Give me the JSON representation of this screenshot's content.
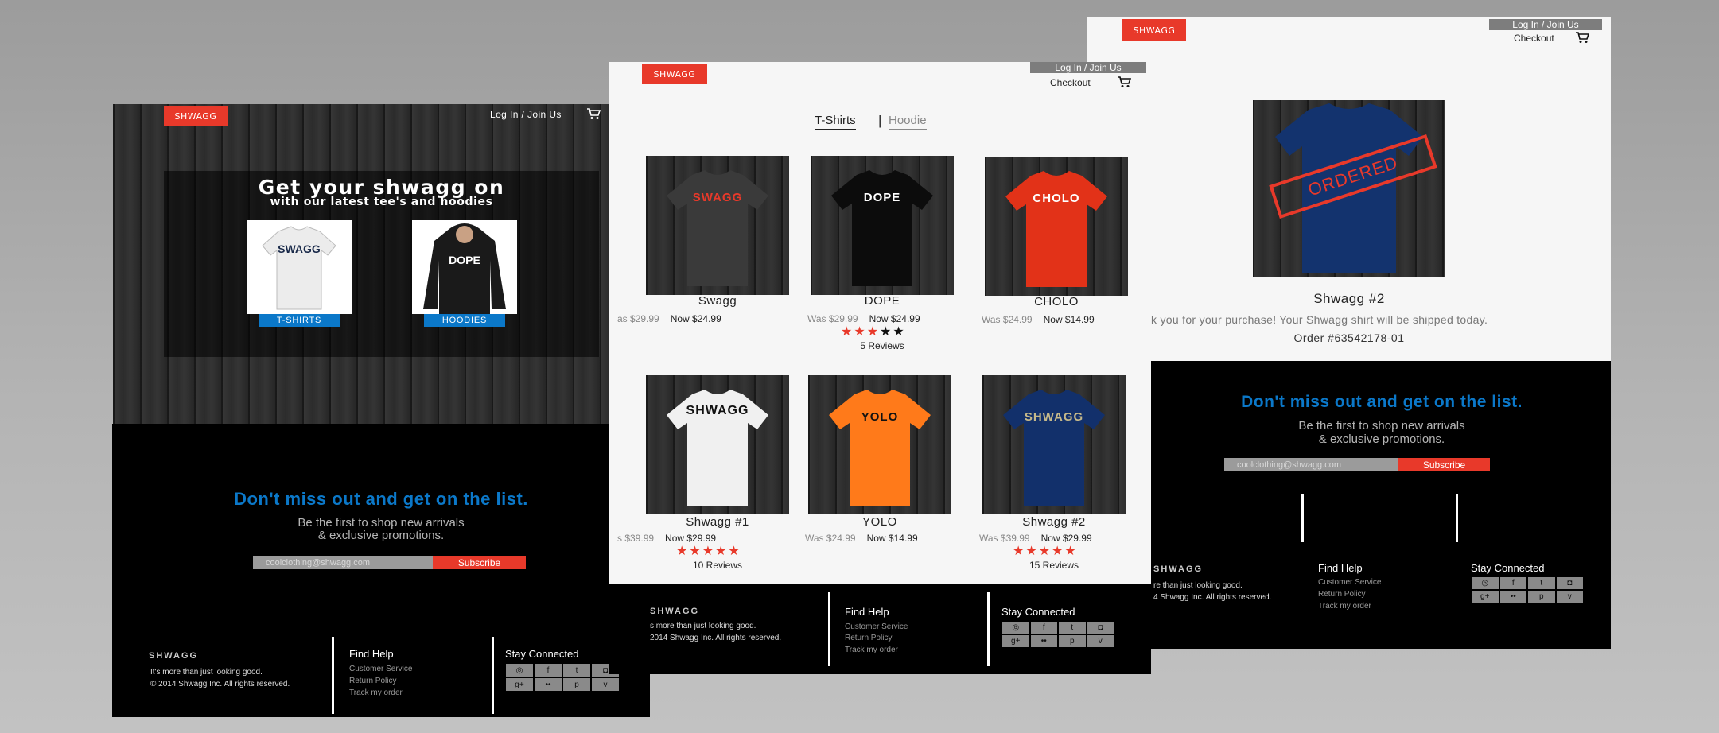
{
  "brand": {
    "logo_text": "SHWAGG",
    "wordmark": "SHWAGG",
    "accent": "#e8392a",
    "blue": "#0b78c9"
  },
  "home": {
    "login": "Log In / Join Us",
    "hero_title": "Get your shwagg on",
    "hero_sub": "with our latest tee's and hoodies",
    "tshirts_label": "T-SHIRTS",
    "hoodies_label": "HOODIES",
    "tee_graphic": "SWAGG",
    "hoodie_graphic": "DOPE"
  },
  "newsletter": {
    "title": "Don't miss out and get on the list.",
    "line1": "Be the first to shop new arrivals",
    "line2": "& exclusive promotions.",
    "email_placeholder": "coolclothing@shwagg.com",
    "subscribe": "Subscribe"
  },
  "footer": {
    "tagline": "It's more than just looking good.",
    "copyright": "2014 Shwagg Inc. All rights reserved.",
    "tagline_cropped": "s more than just looking good.",
    "copyright_cropped": "2014 Shwagg Inc. All rights reserved.",
    "tagline_cropped2": "re than just looking good.",
    "copyright_cropped2": "4 Shwagg Inc. All rights reserved.",
    "help_title": "Find Help",
    "help_links": [
      "Customer Service",
      "Return Policy",
      "Track my order"
    ],
    "social_title": "Stay Connected",
    "social_icons": [
      "dribbble-icon",
      "facebook-icon",
      "twitter-icon",
      "instagram-icon",
      "google-plus-icon",
      "flickr-icon",
      "pinterest-icon",
      "vimeo-icon"
    ]
  },
  "catalog": {
    "login": "Log In / Join Us",
    "checkout": "Checkout",
    "tab_tshirts": "T-Shirts",
    "tab_separator": "|",
    "tab_hoodie": "Hoodie",
    "products": [
      {
        "name": "Swagg",
        "was": "as $29.99",
        "now": "Now $24.99",
        "graphic": "SWAGG",
        "shirt_color": "#3a3a3a",
        "text_color": "#e8392a"
      },
      {
        "name": "DOPE",
        "was": "Was $29.99",
        "now": "Now $24.99",
        "rating": 3,
        "reviews": "5 Reviews",
        "graphic": "DOPE",
        "shirt_color": "#0c0c0c",
        "text_color": "#fff"
      },
      {
        "name": "CHOLO",
        "was": "Was $24.99",
        "now": "Now $14.99",
        "graphic": "CHOLO",
        "shirt_color": "#e23218",
        "text_color": "#fff"
      },
      {
        "name": "Shwagg #1",
        "was": "s $39.99",
        "now": "Now $29.99",
        "rating": 5,
        "reviews": "10 Reviews",
        "graphic": "SHWAGG",
        "shirt_color": "#f0f0f0",
        "text_color": "#111"
      },
      {
        "name": "YOLO",
        "was": "Was $24.99",
        "now": "Now $14.99",
        "graphic": "YOLO",
        "shirt_color": "#ff7a1a",
        "text_color": "#111"
      },
      {
        "name": "Shwagg #2",
        "was": "Was $39.99",
        "now": "Now $29.99",
        "rating": 5,
        "reviews": "15 Reviews",
        "graphic": "SHWAGG",
        "shirt_color": "#12306b",
        "text_color": "#c6b98a"
      }
    ]
  },
  "order": {
    "login": "Log In / Join Us",
    "checkout": "Checkout",
    "product_name": "Shwagg #2",
    "stamp": "ORDERED",
    "thanks": "k you for your purchase! Your Shwagg shirt will be shipped today.",
    "order_number": "Order #63542178-01"
  }
}
